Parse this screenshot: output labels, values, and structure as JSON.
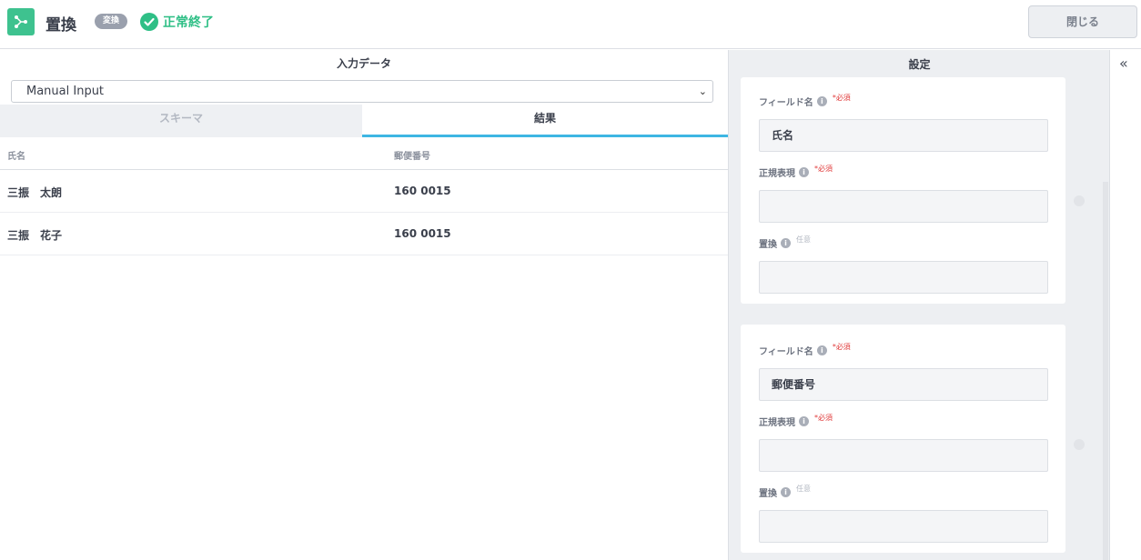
{
  "header": {
    "title": "置換",
    "type_badge": "変換",
    "status": "正常終了",
    "close_label": "閉じる",
    "accent": "#3ec28f",
    "status_color": "#2fbf86"
  },
  "input_panel": {
    "title": "入力データ",
    "source_value": "Manual Input",
    "tabs": [
      {
        "label": "スキーマ",
        "active": false
      },
      {
        "label": "結果",
        "active": true
      }
    ],
    "table": {
      "columns": [
        "氏名",
        "郵便番号"
      ],
      "rows": [
        [
          "三振　太朗",
          "160 0015"
        ],
        [
          "三振　花子",
          "160 0015"
        ]
      ]
    }
  },
  "settings_panel": {
    "title": "設定",
    "rules": [
      {
        "field_label": "フィールド名",
        "field_required": "*必須",
        "field_value": "氏名",
        "regex_label": "正規表現",
        "regex_required": "*必須",
        "regex_value": "",
        "replace_label": "置換",
        "replace_optional": "任意",
        "replace_value": ""
      },
      {
        "field_label": "フィールド名",
        "field_required": "*必須",
        "field_value": "郵便番号",
        "regex_label": "正規表現",
        "regex_required": "*必須",
        "regex_value": "",
        "replace_label": "置換",
        "replace_optional": "任意",
        "replace_value": ""
      }
    ]
  },
  "icons": {
    "app": "workflow-node-icon",
    "status": "check-circle-icon",
    "info": "info-icon",
    "collapse": "double-chevron-left-icon",
    "select": "chevron-down-icon"
  },
  "glyphs": {
    "info": "i",
    "select_chevron": "⌄",
    "collapse": "«"
  }
}
